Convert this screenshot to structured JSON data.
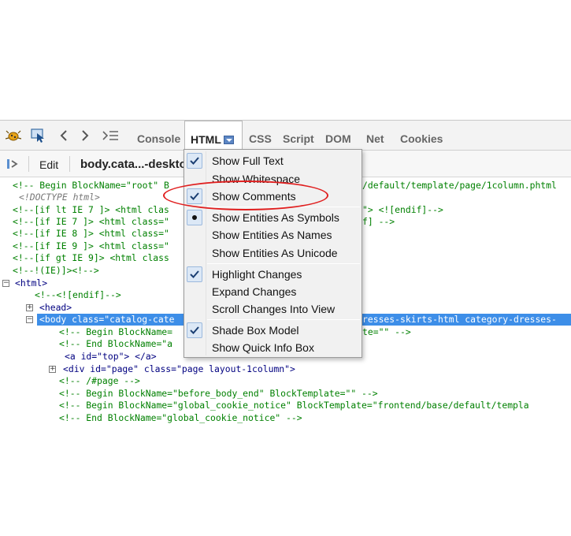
{
  "toolbar": {
    "tabs": [
      "Console",
      "HTML",
      "CSS",
      "Script",
      "DOM",
      "Net",
      "Cookies"
    ],
    "icons": [
      "firebug-icon",
      "inspect-icon",
      "back-icon",
      "forward-icon",
      "command-line-icon"
    ]
  },
  "subbar": {
    "edit_label": "Edit",
    "breadcrumb": "body.cata...-deskto"
  },
  "code_lines": [
    "<!-- Begin BlockName=\"root\" B",
    "<!DOCTYPE html>",
    "<!--[if lt IE 7 ]> <html clas",
    "<!--[if IE 7 ]> <html class=\"",
    "<!--[if IE 8 ]> <html class=\"",
    "<!--[if IE 9 ]> <html class=\"",
    "<!--[if gt IE 9]> <html class",
    "<!--!(IE)]><!-->",
    "<html>",
    "<!--<![endif]-->",
    "<head>",
    "<body class=\"catalog-cate",
    "<!-- Begin BlockName=",
    "<!-- End BlockName=\"a",
    "<a id=\"top\"> </a>",
    "<div id=\"page\" class=\"page layout-1column\">",
    "<!-- /#page -->",
    "<!-- Begin BlockName=\"before_body_end\" BlockTemplate=\"\" -->",
    "<!-- Begin BlockName=\"global_cookie_notice\" BlockTemplate=\"frontend/base/default/templa",
    "<!-- End BlockName=\"global_cookie_notice\" -->"
  ],
  "code_right": [
    "/default/template/page/1column.phtml",
    "\"> <![endif]-->",
    "f] -->",
    "resses-skirts-html category-dresses-",
    "te=\"\" -->"
  ],
  "menu": {
    "items": [
      {
        "label": "Show Full Text",
        "checked": true
      },
      {
        "label": "Show Whitespace",
        "checked": false
      },
      {
        "label": "Show Comments",
        "checked": true
      },
      {
        "label": "Show Entities As Symbols",
        "radio": true
      },
      {
        "label": "Show Entities As Names",
        "radio": false
      },
      {
        "label": "Show Entities As Unicode",
        "radio": false
      },
      {
        "label": "Highlight Changes",
        "checked": true
      },
      {
        "label": "Expand Changes",
        "checked": false
      },
      {
        "label": "Scroll Changes Into View",
        "checked": false
      },
      {
        "label": "Shade Box Model",
        "checked": true
      },
      {
        "label": "Show Quick Info Box",
        "checked": false
      }
    ]
  },
  "colors": {
    "selection": "#3d8ee8",
    "annotation": "#e01f1f",
    "comment_text": "#008000",
    "tag_text": "#000080"
  }
}
